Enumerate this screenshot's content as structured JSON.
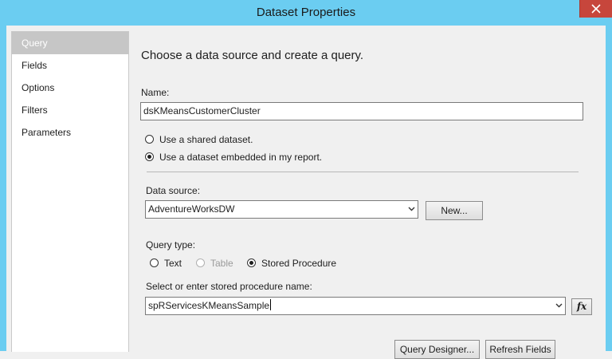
{
  "window": {
    "title": "Dataset Properties"
  },
  "sidebar": {
    "items": [
      {
        "label": "Query",
        "selected": true
      },
      {
        "label": "Fields"
      },
      {
        "label": "Options"
      },
      {
        "label": "Filters"
      },
      {
        "label": "Parameters"
      }
    ]
  },
  "main": {
    "heading": "Choose a data source and create a query.",
    "name_label": "Name:",
    "name_value": "dsKMeansCustomerCluster",
    "dataset_options": [
      {
        "label": "Use a shared dataset.",
        "checked": false
      },
      {
        "label": "Use a dataset embedded in my report.",
        "checked": true
      }
    ],
    "data_source_label": "Data source:",
    "data_source_value": "AdventureWorksDW",
    "new_button": "New...",
    "query_type_label": "Query type:",
    "query_types": [
      {
        "label": "Text",
        "checked": false,
        "enabled": true
      },
      {
        "label": "Table",
        "checked": false,
        "enabled": false
      },
      {
        "label": "Stored Procedure",
        "checked": true,
        "enabled": true
      }
    ],
    "sp_label": "Select or enter stored procedure name:",
    "sp_value": "spRServicesKMeansSample",
    "fx_button": "fx",
    "query_designer_button": "Query Designer...",
    "refresh_fields_button": "Refresh Fields"
  },
  "icons": {
    "close": "close-icon",
    "dropdown": "chevron-down-icon",
    "expression": "fx-icon"
  },
  "colors": {
    "titlebar": "#6bcdf1",
    "close": "#c7463c",
    "nav_selected": "#c6c6c6"
  }
}
